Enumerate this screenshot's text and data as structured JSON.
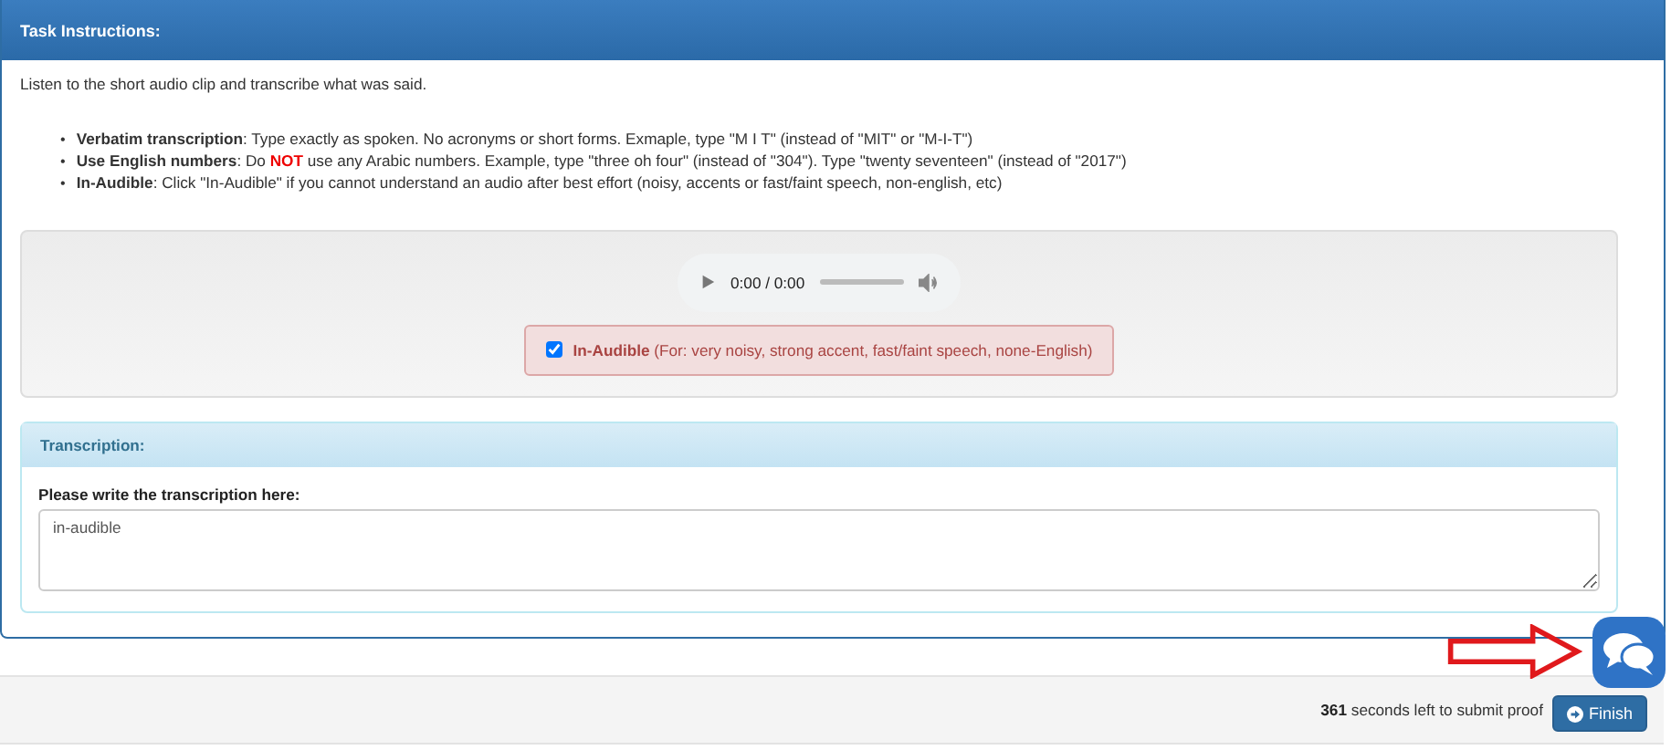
{
  "instructions": {
    "title": "Task Instructions:",
    "intro": "Listen to the short audio clip and transcribe what was said.",
    "rules": [
      {
        "bullet": "•",
        "term": "Verbatim transcription",
        "text": ": Type exactly as spoken. No acronyms or short forms. Exmaple, type \"M I T\" (instead of \"MIT\" or \"M-I-T\")"
      },
      {
        "bullet": "•",
        "term": "Use English numbers",
        "text": ": Do **NOT** use any Arabic numbers. Example, type \"three oh four\" (instead of \"304\"). Type \"twenty seventeen\" (instead of \"2017\")"
      },
      {
        "bullet": "•",
        "term": "In-Audible",
        "text": ": Click \"In-Audible\" if you cannot understand an audio after best effort (noisy, accents or fast/faint speech, non-english, etc)"
      }
    ],
    "player": {
      "time": "0:00 / 0:00"
    },
    "inaudible": {
      "checked": true,
      "label": "In-Audible",
      "note": "(For: very noisy, strong accent, fast/faint speech, none-English)"
    },
    "transcription": {
      "title": "Transcription:",
      "label": "Please write the transcription here:",
      "value": "in-audible"
    }
  },
  "footer": {
    "seconds": "361",
    "text": "seconds left to submit proof",
    "button": "Finish"
  }
}
